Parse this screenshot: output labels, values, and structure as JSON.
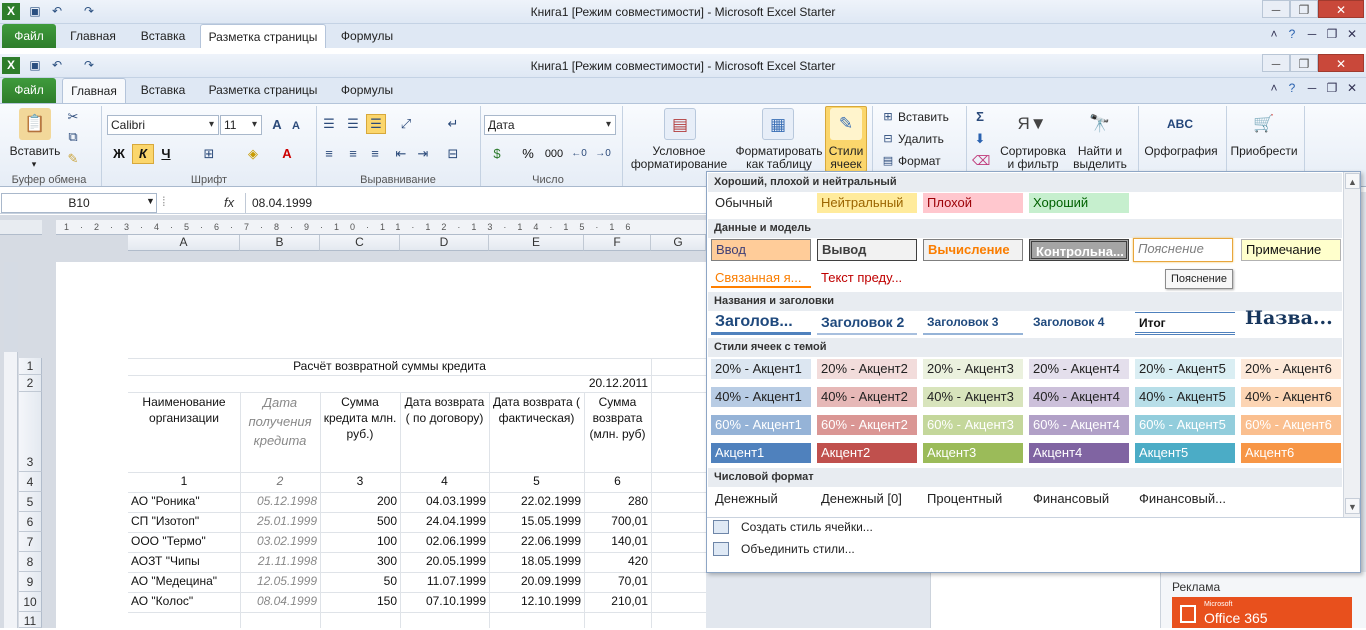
{
  "window": {
    "title": "Книга1  [Режим совместимости]  -  Microsoft Excel Starter"
  },
  "tabs": {
    "file": "Файл",
    "home": "Главная",
    "insert": "Вставка",
    "layout": "Разметка страницы",
    "formulas": "Формулы"
  },
  "ribbon": {
    "clipboard": {
      "paste": "Вставить",
      "label": "Буфер обмена"
    },
    "font": {
      "name": "Calibri",
      "size": "11",
      "bold": "Ж",
      "italic": "К",
      "underline": "Ч",
      "label": "Шрифт"
    },
    "alignment": {
      "label": "Выравнивание"
    },
    "number": {
      "format": "Дата",
      "percent": "%",
      "thousands": "000",
      "label": "Число"
    },
    "styles": {
      "cond1": "Условное",
      "cond2": "форматирование",
      "table1": "Форматировать",
      "table2": "как таблицу",
      "cell1": "Стили",
      "cell2": "ячеек"
    },
    "cells": {
      "insert": "Вставить",
      "delete": "Удалить",
      "format": "Формат"
    },
    "editing": {
      "sort1": "Сортировка",
      "sort2": "и фильтр",
      "find1": "Найти и",
      "find2": "выделить"
    },
    "spelling": "Орфография",
    "apps": "Приобрести"
  },
  "formula_bar": {
    "name_box": "B10",
    "fx": "fx",
    "value": "08.04.1999"
  },
  "columns": [
    "A",
    "B",
    "C",
    "D",
    "E",
    "F",
    "G"
  ],
  "sheet": {
    "title": "Расчёт возвратной суммы кредита",
    "date": "20.12.2011",
    "headers": [
      "Наименование организации",
      "Дата получения кредита",
      "Сумма кредита млн. руб.)",
      "Дата возврата ( по договору)",
      "Дата возврата ( фактическая)",
      "Сумма возврата (млн. руб)"
    ],
    "numbers": [
      "1",
      "2",
      "3",
      "4",
      "5",
      "6"
    ],
    "rows": [
      [
        "АО \"Роника\"",
        "05.12.1998",
        "200",
        "04.03.1999",
        "22.02.1999",
        "280"
      ],
      [
        "СП \"Изотоп\"",
        "25.01.1999",
        "500",
        "24.04.1999",
        "15.05.1999",
        "700,01"
      ],
      [
        "ООО \"Термо\"",
        "03.02.1999",
        "100",
        "02.06.1999",
        "22.06.1999",
        "140,01"
      ],
      [
        "АОЗТ \"Чипы",
        "21.11.1998",
        "300",
        "20.05.1999",
        "18.05.1999",
        "420"
      ],
      [
        "АО \"Медецина\"",
        "12.05.1999",
        "50",
        "11.07.1999",
        "20.09.1999",
        "70,01"
      ],
      [
        "АО \"Колос\"",
        "08.04.1999",
        "150",
        "07.10.1999",
        "12.10.1999",
        "210,01"
      ]
    ],
    "row_numbers": [
      "1",
      "2",
      "3",
      "4",
      "5",
      "6",
      "7",
      "8",
      "9",
      "10",
      "11"
    ]
  },
  "styles_panel": {
    "sections": {
      "good_bad": "Хороший, плохой и нейтральный",
      "data_model": "Данные и модель",
      "titles": "Названия и заголовки",
      "theme": "Стили ячеек с темой",
      "number": "Числовой формат"
    },
    "good_bad": [
      "Обычный",
      "Нейтральный",
      "Плохой",
      "Хороший"
    ],
    "data_model": [
      "Ввод",
      "Вывод",
      "Вычисление",
      "Контрольна...",
      "Пояснение",
      "Примечание",
      "Связанная я...",
      "Текст преду..."
    ],
    "tooltip": "Пояснение",
    "titles": [
      "Заголов...",
      "Заголовок 2",
      "Заголовок 3",
      "Заголовок 4",
      "Итог",
      "Назва..."
    ],
    "accent20": [
      "20% - Акцент1",
      "20% - Акцент2",
      "20% - Акцент3",
      "20% - Акцент4",
      "20% - Акцент5",
      "20% - Акцент6"
    ],
    "accent40": [
      "40% - Акцент1",
      "40% - Акцент2",
      "40% - Акцент3",
      "40% - Акцент4",
      "40% - Акцент5",
      "40% - Акцент6"
    ],
    "accent60": [
      "60% - Акцент1",
      "60% - Акцент2",
      "60% - Акцент3",
      "60% - Акцент4",
      "60% - Акцент5",
      "60% - Акцент6"
    ],
    "accent": [
      "Акцент1",
      "Акцент2",
      "Акцент3",
      "Акцент4",
      "Акцент5",
      "Акцент6"
    ],
    "number": [
      "Денежный",
      "Денежный [0]",
      "Процентный",
      "Финансовый",
      "Финансовый..."
    ],
    "menu": {
      "new_style": "Создать стиль ячейки...",
      "merge": "Объединить стили..."
    }
  },
  "ad": {
    "label": "Реклама",
    "product": "Office 365",
    "brand": "Microsoft"
  }
}
